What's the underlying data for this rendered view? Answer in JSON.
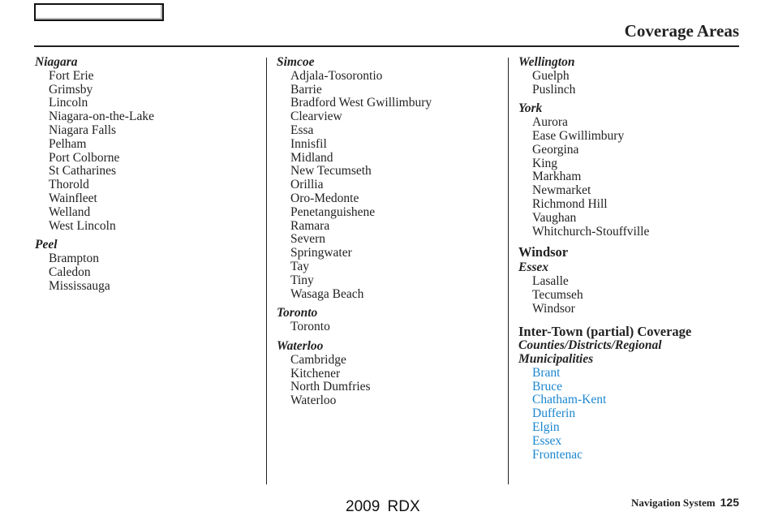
{
  "header": {
    "title": "Coverage Areas"
  },
  "columns": [
    {
      "groups": [
        {
          "name": "Niagara",
          "items": [
            "Fort Erie",
            "Grimsby",
            "Lincoln",
            "Niagara-on-the-Lake",
            "Niagara Falls",
            "Pelham",
            "Port Colborne",
            "St Catharines",
            "Thorold",
            "Wainfleet",
            "Welland",
            "West Lincoln"
          ]
        },
        {
          "name": "Peel",
          "items": [
            "Brampton",
            "Caledon",
            "Mississauga"
          ]
        }
      ]
    },
    {
      "groups": [
        {
          "name": "Simcoe",
          "items": [
            "Adjala-Tosorontio",
            "Barrie",
            "Bradford West Gwillimbury",
            "Clearview",
            "Essa",
            "Innisfil",
            "Midland",
            "New Tecumseth",
            "Orillia",
            "Oro-Medonte",
            "Penetanguishene",
            "Ramara",
            "Severn",
            "Springwater",
            "Tay",
            "Tiny",
            "Wasaga Beach"
          ]
        },
        {
          "name": "Toronto",
          "items": [
            "Toronto"
          ]
        },
        {
          "name": "Waterloo",
          "items": [
            "Cambridge",
            "Kitchener",
            "North Dumfries",
            "Waterloo"
          ]
        }
      ]
    },
    {
      "groups": [
        {
          "name": "Wellington",
          "items": [
            "Guelph",
            "Puslinch"
          ]
        },
        {
          "name": "York",
          "items": [
            "Aurora",
            "Ease Gwillimbury",
            "Georgina",
            "King",
            "Markham",
            "Newmarket",
            "Richmond Hill",
            "Vaughan",
            "Whitchurch-Stouffville"
          ]
        }
      ],
      "windsor": {
        "title": "Windsor",
        "group": {
          "name": "Essex",
          "items": [
            "Lasalle",
            "Tecumseh",
            "Windsor"
          ]
        }
      },
      "intertown": {
        "title": "Inter-Town (partial) Coverage",
        "subtitle_line1": "Counties/Districts/Regional",
        "subtitle_line2": "Municipalities",
        "link_color": "#1a86d0",
        "items": [
          "Brant",
          "Bruce",
          "Chatham-Kent",
          "Dufferin",
          "Elgin",
          "Essex",
          "Frontenac"
        ]
      }
    }
  ],
  "footer": {
    "model": "2009  RDX",
    "section": "Navigation System",
    "page": "125"
  }
}
